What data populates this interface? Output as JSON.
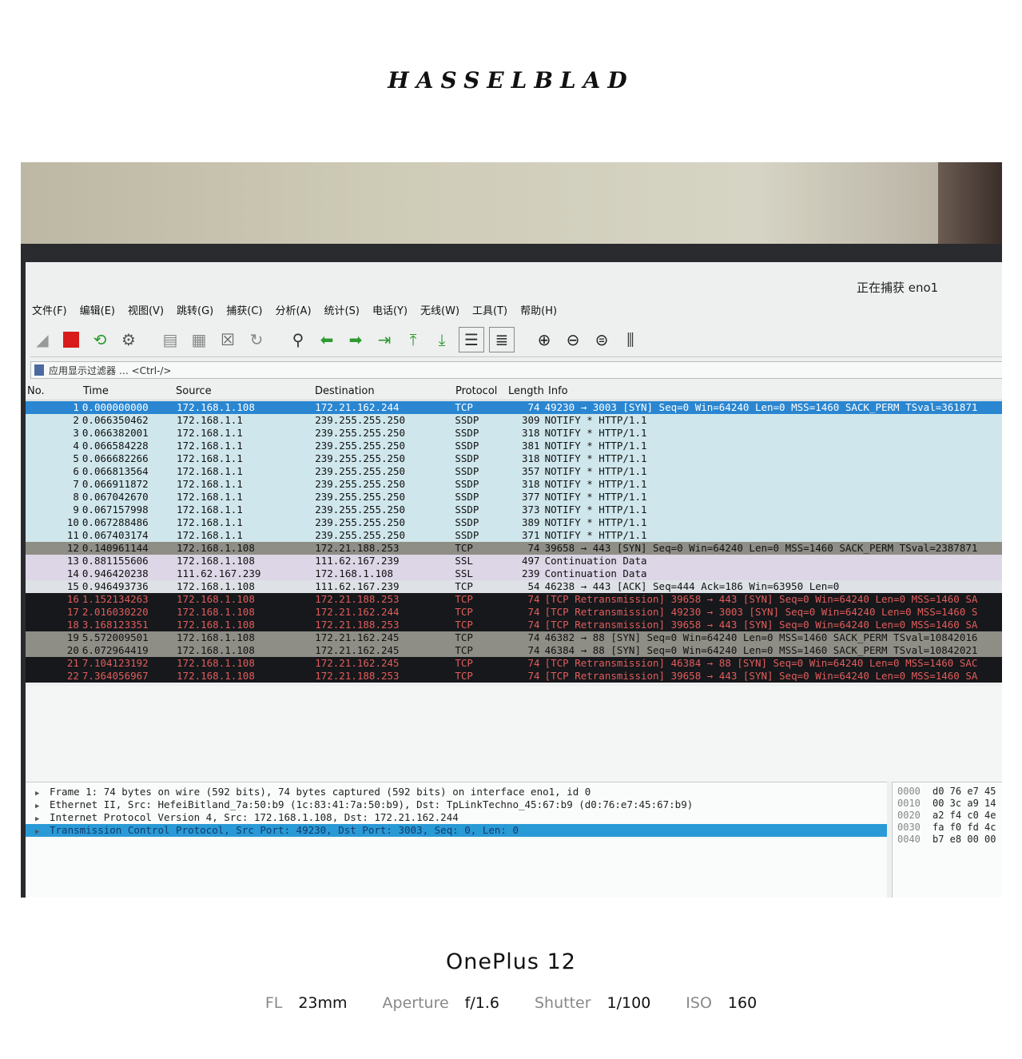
{
  "brand": "HASSELBLAD",
  "window": {
    "capture_status": "正在捕获 eno1"
  },
  "menu": [
    "文件(F)",
    "编辑(E)",
    "视图(V)",
    "跳转(G)",
    "捕获(C)",
    "分析(A)",
    "统计(S)",
    "电话(Y)",
    "无线(W)",
    "工具(T)",
    "帮助(H)"
  ],
  "filter": {
    "placeholder": "应用显示过滤器 … <Ctrl-/>"
  },
  "columns": {
    "no": "No.",
    "time": "Time",
    "source": "Source",
    "destination": "Destination",
    "protocol": "Protocol",
    "length": "Length",
    "info": "Info"
  },
  "packets": [
    {
      "no": "1",
      "time": "0.000000000",
      "src": "172.168.1.108",
      "dst": "172.21.162.244",
      "proto": "TCP",
      "len": "74",
      "info": "49230 → 3003 [SYN] Seq=0 Win=64240 Len=0 MSS=1460 SACK_PERM TSval=361871",
      "style": "sel"
    },
    {
      "no": "2",
      "time": "0.066350462",
      "src": "172.168.1.1",
      "dst": "239.255.255.250",
      "proto": "SSDP",
      "len": "309",
      "info": "NOTIFY * HTTP/1.1",
      "style": "ssdp"
    },
    {
      "no": "3",
      "time": "0.066382001",
      "src": "172.168.1.1",
      "dst": "239.255.255.250",
      "proto": "SSDP",
      "len": "318",
      "info": "NOTIFY * HTTP/1.1",
      "style": "ssdp"
    },
    {
      "no": "4",
      "time": "0.066584228",
      "src": "172.168.1.1",
      "dst": "239.255.255.250",
      "proto": "SSDP",
      "len": "381",
      "info": "NOTIFY * HTTP/1.1",
      "style": "ssdp"
    },
    {
      "no": "5",
      "time": "0.066682266",
      "src": "172.168.1.1",
      "dst": "239.255.255.250",
      "proto": "SSDP",
      "len": "318",
      "info": "NOTIFY * HTTP/1.1",
      "style": "ssdp"
    },
    {
      "no": "6",
      "time": "0.066813564",
      "src": "172.168.1.1",
      "dst": "239.255.255.250",
      "proto": "SSDP",
      "len": "357",
      "info": "NOTIFY * HTTP/1.1",
      "style": "ssdp"
    },
    {
      "no": "7",
      "time": "0.066911872",
      "src": "172.168.1.1",
      "dst": "239.255.255.250",
      "proto": "SSDP",
      "len": "318",
      "info": "NOTIFY * HTTP/1.1",
      "style": "ssdp"
    },
    {
      "no": "8",
      "time": "0.067042670",
      "src": "172.168.1.1",
      "dst": "239.255.255.250",
      "proto": "SSDP",
      "len": "377",
      "info": "NOTIFY * HTTP/1.1",
      "style": "ssdp"
    },
    {
      "no": "9",
      "time": "0.067157998",
      "src": "172.168.1.1",
      "dst": "239.255.255.250",
      "proto": "SSDP",
      "len": "373",
      "info": "NOTIFY * HTTP/1.1",
      "style": "ssdp"
    },
    {
      "no": "10",
      "time": "0.067288486",
      "src": "172.168.1.1",
      "dst": "239.255.255.250",
      "proto": "SSDP",
      "len": "389",
      "info": "NOTIFY * HTTP/1.1",
      "style": "ssdp"
    },
    {
      "no": "11",
      "time": "0.067403174",
      "src": "172.168.1.1",
      "dst": "239.255.255.250",
      "proto": "SSDP",
      "len": "371",
      "info": "NOTIFY * HTTP/1.1",
      "style": "ssdp"
    },
    {
      "no": "12",
      "time": "0.140961144",
      "src": "172.168.1.108",
      "dst": "172.21.188.253",
      "proto": "TCP",
      "len": "74",
      "info": "39658 → 443 [SYN] Seq=0 Win=64240 Len=0 MSS=1460 SACK_PERM TSval=2387871",
      "style": "tcpgrey"
    },
    {
      "no": "13",
      "time": "0.881155606",
      "src": "172.168.1.108",
      "dst": "111.62.167.239",
      "proto": "SSL",
      "len": "497",
      "info": "Continuation Data",
      "style": "ssl"
    },
    {
      "no": "14",
      "time": "0.946420238",
      "src": "111.62.167.239",
      "dst": "172.168.1.108",
      "proto": "SSL",
      "len": "239",
      "info": "Continuation Data",
      "style": "ssl"
    },
    {
      "no": "15",
      "time": "0.946493736",
      "src": "172.168.1.108",
      "dst": "111.62.167.239",
      "proto": "TCP",
      "len": "54",
      "info": "46238 → 443 [ACK] Seq=444 Ack=186 Win=63950 Len=0",
      "style": "ack"
    },
    {
      "no": "16",
      "time": "1.152134263",
      "src": "172.168.1.108",
      "dst": "172.21.188.253",
      "proto": "TCP",
      "len": "74",
      "info": "[TCP Retransmission] 39658 → 443 [SYN] Seq=0 Win=64240 Len=0 MSS=1460 SA",
      "style": "bad"
    },
    {
      "no": "17",
      "time": "2.016030220",
      "src": "172.168.1.108",
      "dst": "172.21.162.244",
      "proto": "TCP",
      "len": "74",
      "info": "[TCP Retransmission] 49230 → 3003 [SYN] Seq=0 Win=64240 Len=0 MSS=1460 S",
      "style": "bad"
    },
    {
      "no": "18",
      "time": "3.168123351",
      "src": "172.168.1.108",
      "dst": "172.21.188.253",
      "proto": "TCP",
      "len": "74",
      "info": "[TCP Retransmission] 39658 → 443 [SYN] Seq=0 Win=64240 Len=0 MSS=1460 SA",
      "style": "bad"
    },
    {
      "no": "19",
      "time": "5.572009501",
      "src": "172.168.1.108",
      "dst": "172.21.162.245",
      "proto": "TCP",
      "len": "74",
      "info": "46382 → 88 [SYN] Seq=0 Win=64240 Len=0 MSS=1460 SACK_PERM TSval=10842016",
      "style": "tcpgrey"
    },
    {
      "no": "20",
      "time": "6.072964419",
      "src": "172.168.1.108",
      "dst": "172.21.162.245",
      "proto": "TCP",
      "len": "74",
      "info": "46384 → 88 [SYN] Seq=0 Win=64240 Len=0 MSS=1460 SACK_PERM TSval=10842021",
      "style": "tcpgrey"
    },
    {
      "no": "21",
      "time": "7.104123192",
      "src": "172.168.1.108",
      "dst": "172.21.162.245",
      "proto": "TCP",
      "len": "74",
      "info": "[TCP Retransmission] 46384 → 88 [SYN] Seq=0 Win=64240 Len=0 MSS=1460 SAC",
      "style": "bad"
    },
    {
      "no": "22",
      "time": "7.364056967",
      "src": "172.168.1.108",
      "dst": "172.21.188.253",
      "proto": "TCP",
      "len": "74",
      "info": "[TCP Retransmission] 39658 → 443 [SYN] Seq=0 Win=64240 Len=0 MSS=1460 SA",
      "style": "bad"
    }
  ],
  "details": [
    "Frame 1: 74 bytes on wire (592 bits), 74 bytes captured (592 bits) on interface eno1, id 0",
    "Ethernet II, Src: HefeiBitland_7a:50:b9 (1c:83:41:7a:50:b9), Dst: TpLinkTechno_45:67:b9 (d0:76:e7:45:67:b9)",
    "Internet Protocol Version 4, Src: 172.168.1.108, Dst: 172.21.162.244",
    "Transmission Control Protocol, Src Port: 49230, Dst Port: 3003, Seq: 0, Len: 0"
  ],
  "hex": [
    {
      "offset": "0000",
      "bytes": "d0 76 e7 45"
    },
    {
      "offset": "0010",
      "bytes": "00 3c a9 14"
    },
    {
      "offset": "0020",
      "bytes": "a2 f4 c0 4e"
    },
    {
      "offset": "0030",
      "bytes": "fa f0 fd 4c"
    },
    {
      "offset": "0040",
      "bytes": "b7 e8 00 00"
    }
  ],
  "device": "OnePlus 12",
  "exif": [
    {
      "label": "FL",
      "value": "23mm"
    },
    {
      "label": "Aperture",
      "value": "f/1.6"
    },
    {
      "label": "Shutter",
      "value": "1/100"
    },
    {
      "label": "ISO",
      "value": "160"
    }
  ],
  "colors": {
    "selected_row": "#2a86d0",
    "ssdp_row": "#cfe7ec",
    "bad_row_bg": "#16181b",
    "bad_row_fg": "#e25c5c"
  }
}
